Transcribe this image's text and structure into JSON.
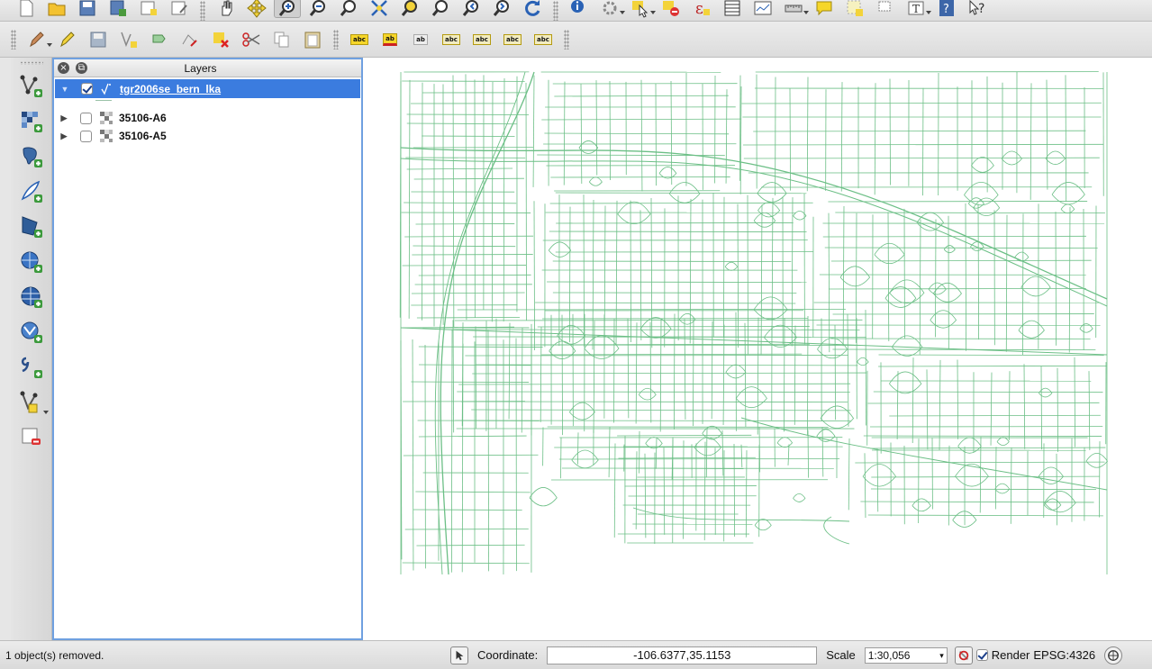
{
  "toolbar_row1": {
    "groups": [
      [
        "new-project-icon",
        "open-project-icon",
        "save-project-icon",
        "save-as-icon",
        "new-print-composer-icon",
        "composer-manager-icon"
      ],
      [
        "pan-icon",
        "pan-to-selection-icon",
        "zoom-in-icon",
        "zoom-out-icon",
        "zoom-native-icon",
        "zoom-full-icon",
        "zoom-to-selection-icon",
        "zoom-to-layer-icon",
        "zoom-last-icon",
        "zoom-next-icon",
        "refresh-icon"
      ],
      [
        "identify-icon",
        "action-icon",
        "select-features-icon",
        "deselect-icon",
        "field-calculator-icon",
        "attribute-table-icon",
        "statistics-icon",
        "measure-icon",
        "annotation-icon",
        "text-annotation-icon",
        "form-annotation-icon",
        "tips-icon",
        "help-icon",
        "whats-this-icon"
      ]
    ],
    "selected": "zoom-in-icon"
  },
  "toolbar_row2": {
    "groups": [
      [
        "toggle-editing-icon",
        "current-edits-icon",
        "save-edits-icon",
        "add-feature-icon",
        "move-feature-icon",
        "node-tool-icon",
        "delete-selected-icon",
        "cut-features-icon",
        "copy-features-icon",
        "paste-features-icon"
      ],
      [
        "label-tool-icon",
        "pin-labels-icon",
        "show-hide-labels-icon",
        "move-label-icon",
        "rotate-label-icon",
        "change-label-icon",
        "highlight-labels-icon"
      ]
    ],
    "abc_text": "abc",
    "ab_text": "ab"
  },
  "left_toolbar": {
    "items": [
      "add-vector-layer-icon",
      "add-raster-layer-icon",
      "add-postgis-layer-icon",
      "add-spatialite-layer-icon",
      "add-mssql-layer-icon",
      "add-wms-layer-icon",
      "add-wcs-layer-icon",
      "add-wfs-layer-icon",
      "add-delimited-text-layer-icon",
      "new-shapefile-layer-icon",
      "remove-layer-icon"
    ]
  },
  "layers_panel": {
    "title": "Layers",
    "layers": [
      {
        "name": "tgr2006se_bern_lka",
        "checked": true,
        "expanded": true,
        "type": "vector"
      },
      {
        "name": "35106-A6",
        "checked": false,
        "expanded": false,
        "type": "raster"
      },
      {
        "name": "35106-A5",
        "checked": false,
        "expanded": false,
        "type": "raster"
      }
    ]
  },
  "map": {
    "line_color": "#6cbf86",
    "background": "#ffffff"
  },
  "statusbar": {
    "message": "1 object(s) removed.",
    "coordinate_label": "Coordinate:",
    "coordinate_value": "-106.6377,35.1153",
    "scale_label": "Scale",
    "scale_value": "1:30,056",
    "render_label": "Render",
    "render_checked": true,
    "crs": "EPSG:4326"
  }
}
